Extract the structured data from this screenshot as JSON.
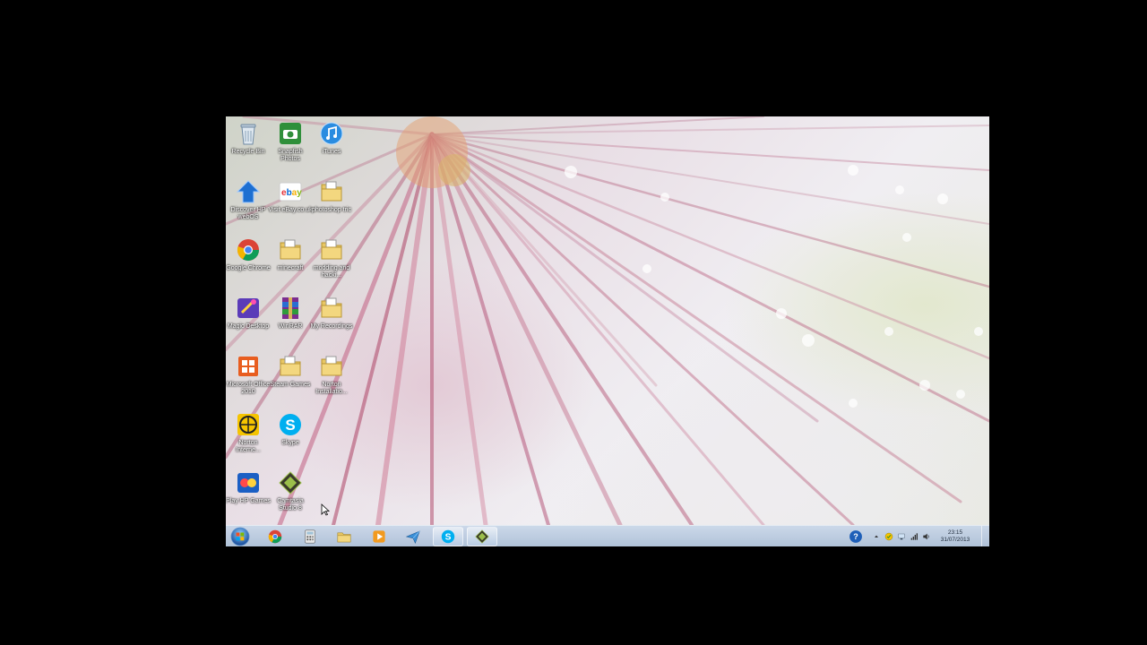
{
  "desktop": {
    "icons": [
      {
        "label": "Recycle Bin",
        "icon": "recycle-bin-icon"
      },
      {
        "label": "Snapfish Photos",
        "icon": "snapfish-icon"
      },
      {
        "label": "iTunes",
        "icon": "itunes-icon"
      },
      {
        "label": "Discover HP webOS",
        "icon": "hp-webos-icon"
      },
      {
        "label": "Visit eBay.co.uk",
        "icon": "ebay-icon"
      },
      {
        "label": "photoshop tric",
        "icon": "folder-icon"
      },
      {
        "label": "Google Chrome",
        "icon": "chrome-icon"
      },
      {
        "label": "minecraft",
        "icon": "folder-icon"
      },
      {
        "label": "modding and hacki...",
        "icon": "folder-icon"
      },
      {
        "label": "Magic Desktop",
        "icon": "magic-desktop-icon"
      },
      {
        "label": "WinRAR",
        "icon": "winrar-icon"
      },
      {
        "label": "My Recordings",
        "icon": "folder-icon"
      },
      {
        "label": "Microsoft Office 2010",
        "icon": "office-icon"
      },
      {
        "label": "Steam Games",
        "icon": "folder-icon"
      },
      {
        "label": "Norton Installatio...",
        "icon": "folder-icon"
      },
      {
        "label": "Norton Interne...",
        "icon": "norton-icon"
      },
      {
        "label": "Skype",
        "icon": "skype-icon"
      },
      {
        "label": "Play HP Games",
        "icon": "hp-games-icon"
      },
      {
        "label": "Camtasia Studio 8",
        "icon": "camtasia-icon"
      }
    ]
  },
  "taskbar": {
    "start": {
      "icon": "windows-start-icon"
    },
    "pinned": [
      {
        "icon": "chrome-icon",
        "active": false
      },
      {
        "icon": "calculator-icon",
        "active": false
      },
      {
        "icon": "file-explorer-icon",
        "active": false
      },
      {
        "icon": "media-player-icon",
        "active": false
      },
      {
        "icon": "paper-plane-icon",
        "active": false
      },
      {
        "icon": "skype-icon",
        "active": true
      },
      {
        "icon": "camtasia-icon",
        "active": true
      }
    ],
    "tray": {
      "icons": [
        "help-icon",
        "show-hidden-icon",
        "norton-tray-icon",
        "network-icon",
        "signal-icon",
        "volume-icon"
      ],
      "time": "23:15",
      "date": "31/07/2013"
    }
  }
}
